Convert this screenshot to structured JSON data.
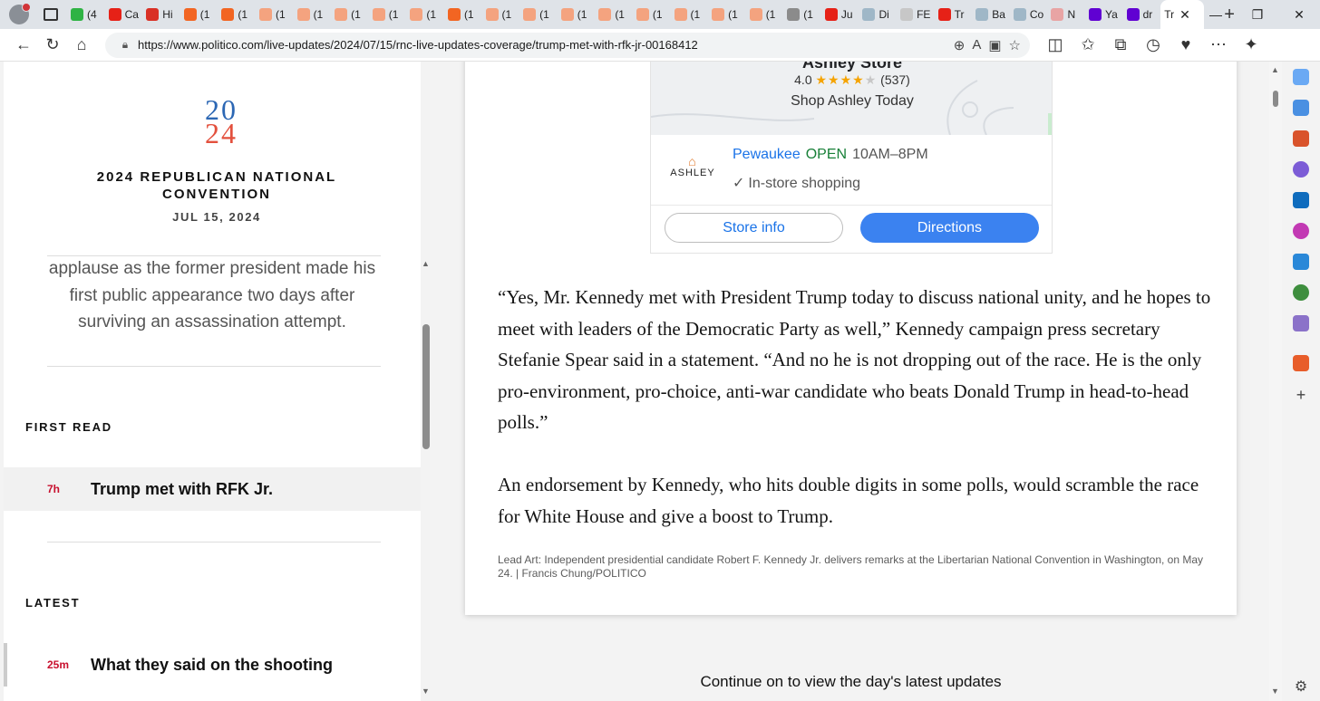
{
  "browser": {
    "tabs": [
      {
        "label": "(4",
        "color": "#2fb344"
      },
      {
        "label": "Ca",
        "color": "#e62117"
      },
      {
        "label": "Hi",
        "color": "#d93025"
      },
      {
        "label": "(1",
        "color": "#f26522"
      },
      {
        "label": "(1",
        "color": "#f26522"
      },
      {
        "label": "(1",
        "color": "#f4a37f"
      },
      {
        "label": "(1",
        "color": "#f4a37f"
      },
      {
        "label": "(1",
        "color": "#f4a37f"
      },
      {
        "label": "(1",
        "color": "#f4a37f"
      },
      {
        "label": "(1",
        "color": "#f4a37f"
      },
      {
        "label": "(1",
        "color": "#f26522"
      },
      {
        "label": "(1",
        "color": "#f4a37f"
      },
      {
        "label": "(1",
        "color": "#f4a37f"
      },
      {
        "label": "(1",
        "color": "#f4a37f"
      },
      {
        "label": "(1",
        "color": "#f4a37f"
      },
      {
        "label": "(1",
        "color": "#f4a37f"
      },
      {
        "label": "(1",
        "color": "#f4a37f"
      },
      {
        "label": "(1",
        "color": "#f4a37f"
      },
      {
        "label": "(1",
        "color": "#f4a37f"
      },
      {
        "label": "(1",
        "color": "#8b8b8b"
      },
      {
        "label": "Ju",
        "color": "#e62117"
      },
      {
        "label": "Di",
        "color": "#9fb7c7"
      },
      {
        "label": "FE",
        "color": "#c7c7c7"
      },
      {
        "label": "Tr",
        "color": "#e62117"
      },
      {
        "label": "Ba",
        "color": "#9fb7c7"
      },
      {
        "label": "Co",
        "color": "#9fb7c7"
      },
      {
        "label": "N",
        "color": "#e8a4a4"
      },
      {
        "label": "Ya",
        "color": "#6001d2"
      },
      {
        "label": "dr",
        "color": "#6001d2"
      }
    ],
    "active_tab": {
      "label": "Tr"
    },
    "new_tab": "+",
    "window": {
      "minimize": "—",
      "restore": "❐",
      "close": "✕"
    },
    "url": "https://www.politico.com/live-updates/2024/07/15/rnc-live-updates-coverage/trump-met-with-rfk-jr-00168412"
  },
  "rail": {
    "logo_top": "20",
    "logo_bottom": "24",
    "event_title": "2024 REPUBLICAN NATIONAL CONVENTION",
    "event_date": "JUL 15, 2024",
    "excerpt": "applause as the former president made his first public appearance two days after surviving an assassination attempt.",
    "first_read_heading": "FIRST READ",
    "first_read_item": {
      "age": "7h",
      "title": "Trump met with RFK Jr."
    },
    "latest_heading": "LATEST",
    "latest_item": {
      "age": "25m",
      "title": "What they said on the shooting"
    }
  },
  "ad": {
    "store_name": "Ashley Store",
    "rating": "4.0",
    "stars_on": "★★★★",
    "stars_off": "★",
    "review_count": "(537)",
    "tagline": "Shop Ashley Today",
    "brand": "ASHLEY",
    "city": "Pewaukee",
    "status": "OPEN",
    "hours": "10AM–8PM",
    "service": "In-store shopping",
    "store_info_label": "Store info",
    "directions_label": "Directions"
  },
  "article": {
    "paragraph_1": "“Yes, Mr. Kennedy met with President Trump today to discuss national unity, and he hopes to meet with leaders of the Democratic Party as well,” Kennedy campaign press secretary Stefanie Spear said in a statement. “And no he is not dropping out of the race. He is the only pro-environment, pro-choice, anti-war candidate who beats Donald Trump in head-to-head polls.”",
    "paragraph_2": "An endorsement by Kennedy, who hits double digits in some polls, would scramble the race for White House and give a boost to Trump.",
    "caption": "Lead Art: Independent presidential candidate Robert F. Kennedy Jr. delivers remarks at the Libertarian National Convention in Washington, on May 24. | Francis Chung/POLITICO",
    "continue": "Continue on to view the day's latest updates"
  },
  "colors": {
    "accent_red": "#c8102e",
    "link_blue": "#1a73e8",
    "open_green": "#188038",
    "directions_blue": "#3b82f0"
  }
}
